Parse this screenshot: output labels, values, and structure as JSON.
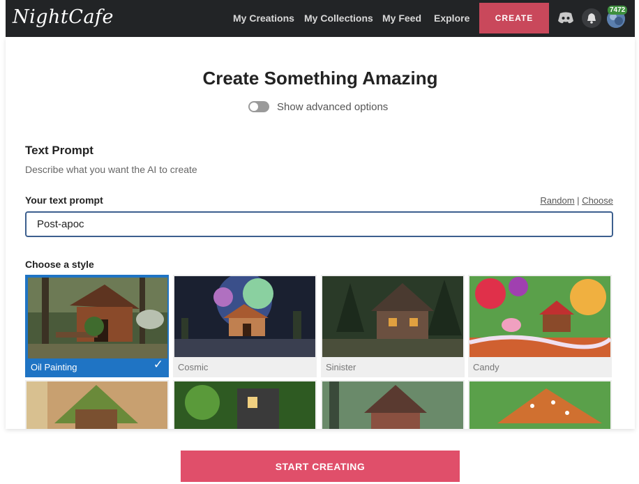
{
  "app": {
    "logo_text": "NightCafe"
  },
  "nav": {
    "items": [
      "My Creations",
      "My Collections",
      "My Feed",
      "Explore"
    ],
    "create_label": "CREATE"
  },
  "header_icons": {
    "discord": "discord-icon",
    "bell": "bell-icon",
    "avatar": "avatar",
    "credits": "7472"
  },
  "main": {
    "title": "Create Something Amazing",
    "advanced_toggle": {
      "label": "Show advanced options",
      "on": false
    },
    "section_title": "Text Prompt",
    "section_desc": "Describe what you want the AI to create",
    "prompt_label": "Your text prompt",
    "random_link": "Random",
    "link_separator": "|",
    "choose_link": "Choose",
    "prompt_value": "Post-apoc",
    "style_label": "Choose a style",
    "styles": [
      {
        "name": "Oil Painting",
        "selected": true
      },
      {
        "name": "Cosmic",
        "selected": false
      },
      {
        "name": "Sinister",
        "selected": false
      },
      {
        "name": "Candy",
        "selected": false
      }
    ]
  },
  "footer": {
    "start_label": "START CREATING"
  },
  "colors": {
    "topbar": "#222426",
    "create": "#c9485b",
    "selected": "#1f74c4",
    "start": "#e04f6a",
    "input_border": "#3c5f8e"
  }
}
